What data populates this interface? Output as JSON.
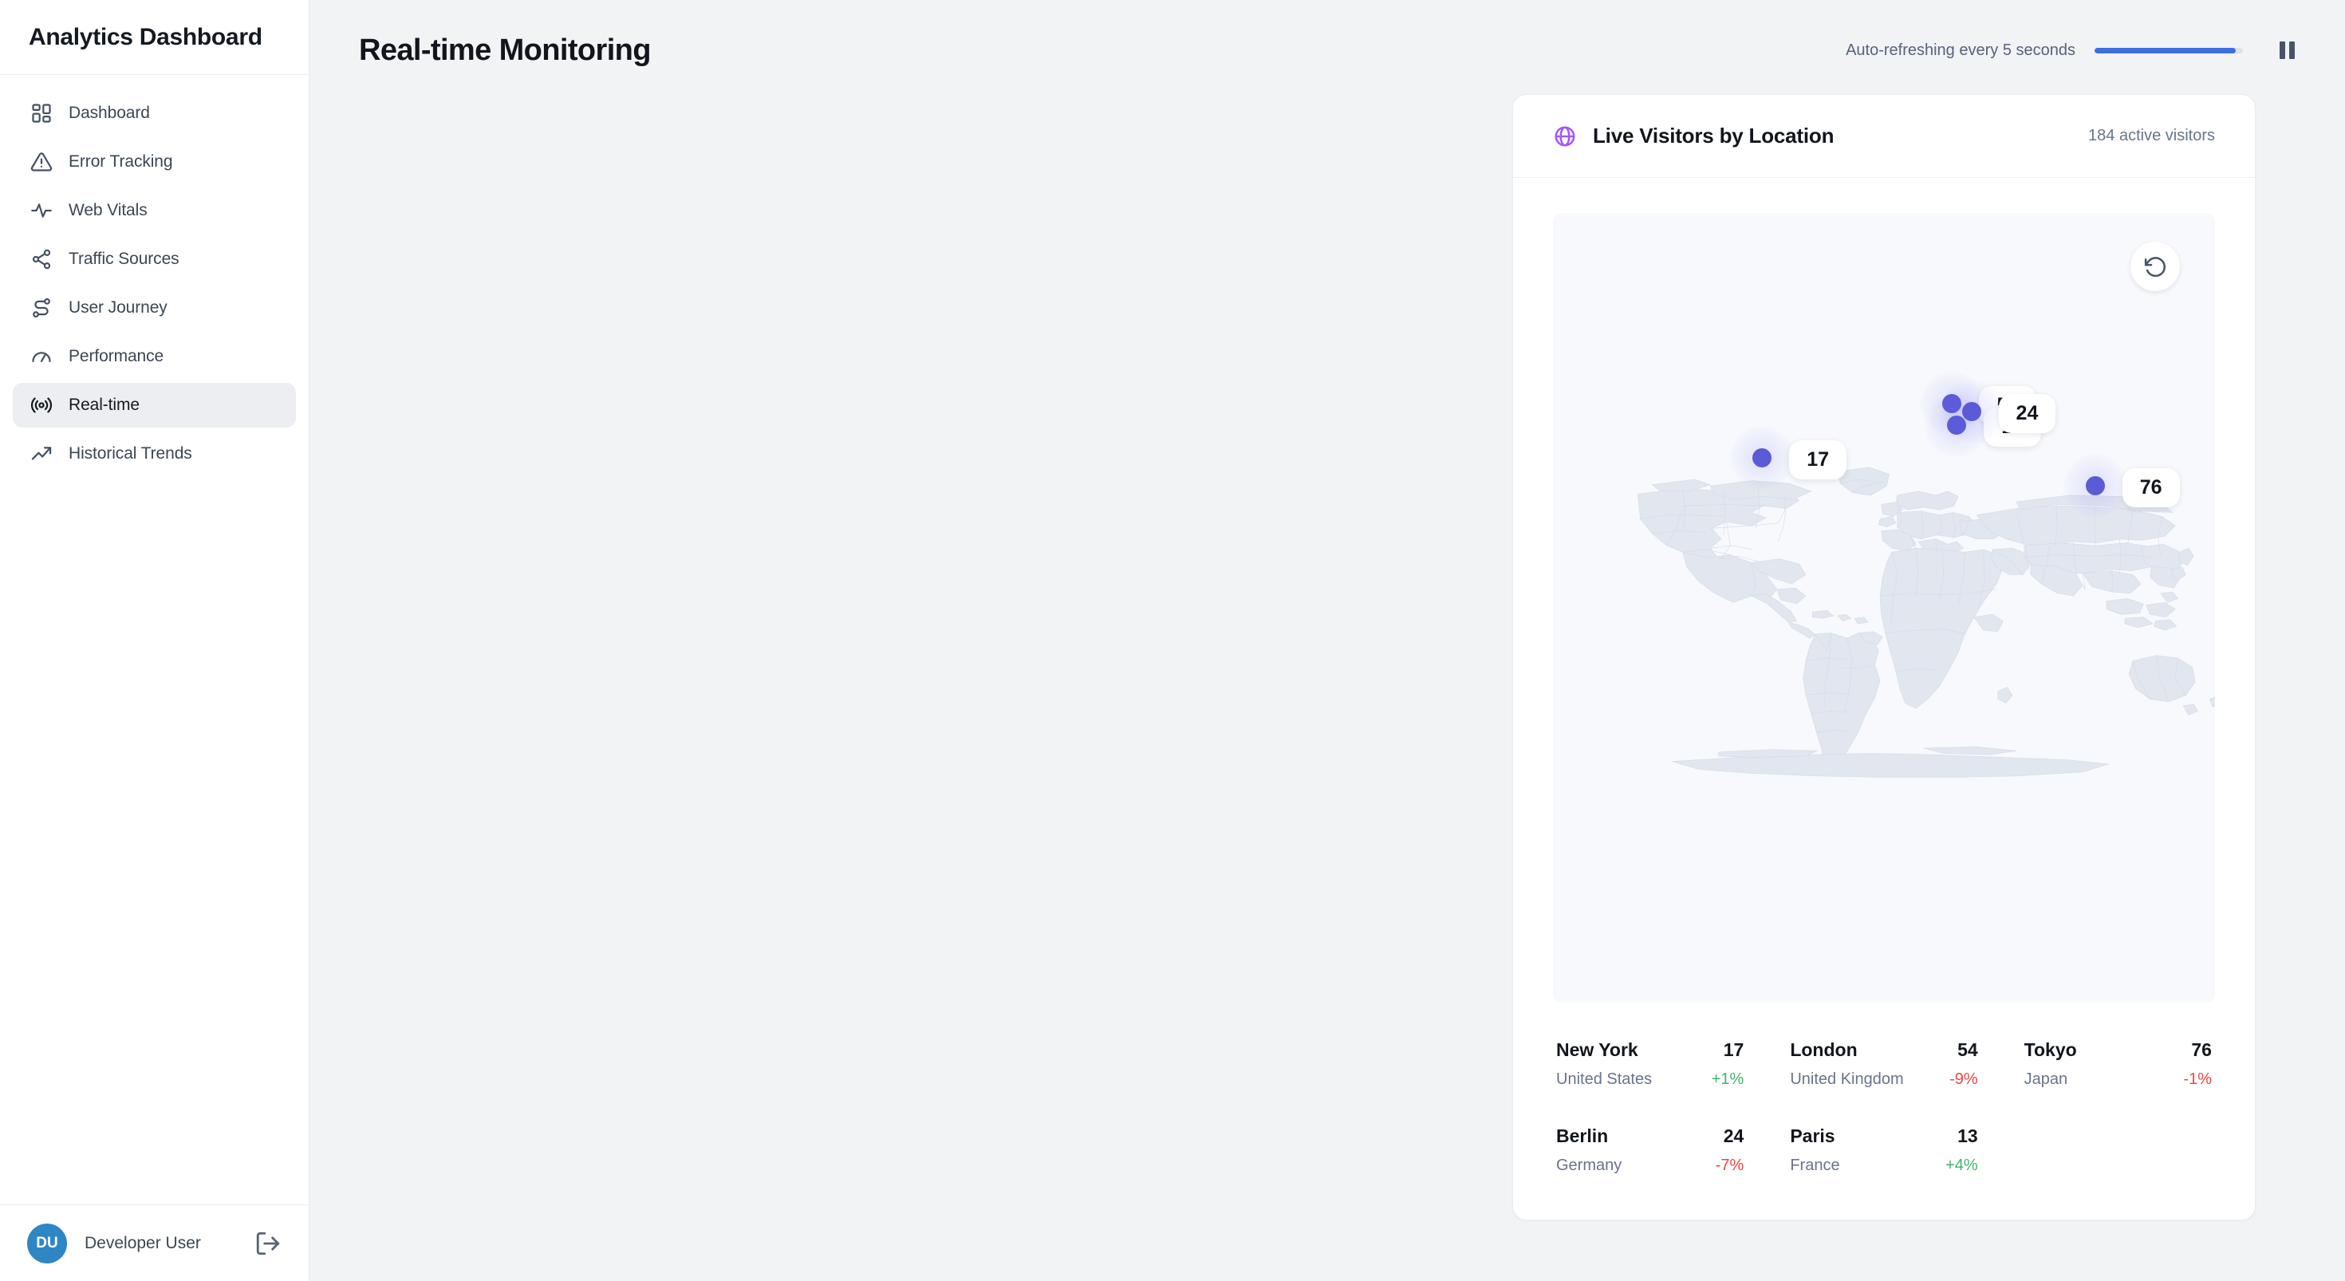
{
  "sidebar": {
    "brand": "Analytics Dashboard",
    "items": [
      {
        "label": "Dashboard",
        "icon": "grid-icon",
        "active": false
      },
      {
        "label": "Error Tracking",
        "icon": "alert-triangle-icon",
        "active": false
      },
      {
        "label": "Web Vitals",
        "icon": "activity-icon",
        "active": false
      },
      {
        "label": "Traffic Sources",
        "icon": "share-icon",
        "active": false
      },
      {
        "label": "User Journey",
        "icon": "route-icon",
        "active": false
      },
      {
        "label": "Performance",
        "icon": "gauge-icon",
        "active": false
      },
      {
        "label": "Real-time",
        "icon": "broadcast-icon",
        "active": true
      },
      {
        "label": "Historical Trends",
        "icon": "trending-up-icon",
        "active": false
      }
    ],
    "user": {
      "initials": "DU",
      "name": "Developer User",
      "avatar_color": "#2f86c5",
      "logout_icon": "logout-icon"
    }
  },
  "header": {
    "title": "Real-time Monitoring",
    "refresh_text": "Auto-refreshing every 5 seconds",
    "refresh_progress": 95,
    "refresh_bar_color": "#3b6fe0",
    "pause_icon": "pause-icon"
  },
  "card": {
    "icon": "globe-icon",
    "icon_color": "#a855f7",
    "title": "Live Visitors by Location",
    "meta": "184 active visitors",
    "reset_icon": "rotate-ccw-icon"
  },
  "map": {
    "marker_color": "#5b5bd6",
    "land_color": "#e2e6ef",
    "border_color": "#d3d9e6",
    "ocean_color": "#f7f9fc",
    "markers": [
      {
        "city": "New York",
        "value": "17",
        "x": 31.6,
        "y": 31.0
      },
      {
        "city": "London",
        "value": "54",
        "x": 60.3,
        "y": 24.1
      },
      {
        "city": "Paris",
        "value": "13",
        "x": 61.0,
        "y": 26.9
      },
      {
        "city": "Berlin",
        "value": "24",
        "x": 63.2,
        "y": 25.2
      },
      {
        "city": "Tokyo",
        "value": "76",
        "x": 81.9,
        "y": 34.5
      }
    ]
  },
  "chart_data": {
    "type": "map",
    "title": "Live Visitors by Location",
    "total_label": "184 active visitors",
    "total": 184,
    "value_label": "active visitors",
    "categories": [
      "New York",
      "London",
      "Tokyo",
      "Berlin",
      "Paris"
    ],
    "values": [
      17,
      54,
      76,
      24,
      13
    ],
    "changes": [
      "+1%",
      "-9%",
      "-1%",
      "-7%",
      "+4%"
    ],
    "countries": [
      "United States",
      "United Kingdom",
      "Japan",
      "Germany",
      "France"
    ]
  },
  "locations": [
    {
      "city": "New York",
      "country": "United States",
      "count": "17",
      "change": "+1%",
      "direction": "up"
    },
    {
      "city": "London",
      "country": "United Kingdom",
      "count": "54",
      "change": "-9%",
      "direction": "down"
    },
    {
      "city": "Tokyo",
      "country": "Japan",
      "count": "76",
      "change": "-1%",
      "direction": "down"
    },
    {
      "city": "Berlin",
      "country": "Germany",
      "count": "24",
      "change": "-7%",
      "direction": "down"
    },
    {
      "city": "Paris",
      "country": "France",
      "count": "13",
      "change": "+4%",
      "direction": "up"
    }
  ]
}
